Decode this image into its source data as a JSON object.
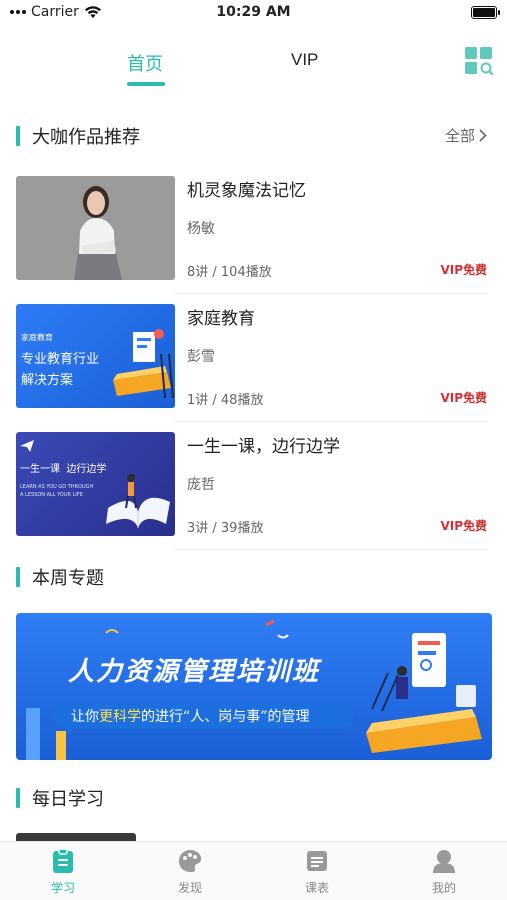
{
  "status_bar": {
    "carrier": "Carrier",
    "time": "10:29 AM"
  },
  "top_nav": {
    "tabs": [
      {
        "label": "首页",
        "active": true
      },
      {
        "label": "VIP",
        "active": false
      }
    ],
    "icon": "grid-search-icon",
    "accent": "#2bbcb0"
  },
  "featured": {
    "title": "大咖作品推荐",
    "see_all": "全部",
    "courses": [
      {
        "title": "机灵象魔法记忆",
        "author": "杨敏",
        "stats": "8讲 / 104播放",
        "tag": "VIP免费"
      },
      {
        "title": "家庭教育",
        "author": "彭雪",
        "stats": "1讲 / 48播放",
        "tag": "VIP免费",
        "thumb_text": {
          "small": "家庭教育",
          "line1": "专业教育行业",
          "line2": "解决方案"
        }
      },
      {
        "title": "一生一课，边行边学",
        "author": "庞哲",
        "stats": "3讲 / 39播放",
        "tag": "VIP免费",
        "thumb_text": {
          "main": "一生一课  边行边学",
          "en1": "LEARN AS YOU GO THROUGH",
          "en2": "A LESSON ALL YOUR LIFE"
        }
      }
    ]
  },
  "weekly": {
    "title": "本周专题",
    "banner": {
      "title": "人力资源管理培训班",
      "sub_pre": "让你",
      "sub_hl": "更科学",
      "sub_post": "的进行“人、岗与事”的管理"
    }
  },
  "daily": {
    "title": "每日学习"
  },
  "tab_bar": {
    "items": [
      {
        "label": "学习",
        "icon": "study-icon",
        "active": true
      },
      {
        "label": "发现",
        "icon": "discover-icon",
        "active": false
      },
      {
        "label": "课表",
        "icon": "schedule-icon",
        "active": false
      },
      {
        "label": "我的",
        "icon": "profile-icon",
        "active": false
      }
    ]
  },
  "colors": {
    "accent": "#2bbcb0",
    "vip": "#d2312f",
    "banner": "#1b5fd6"
  }
}
